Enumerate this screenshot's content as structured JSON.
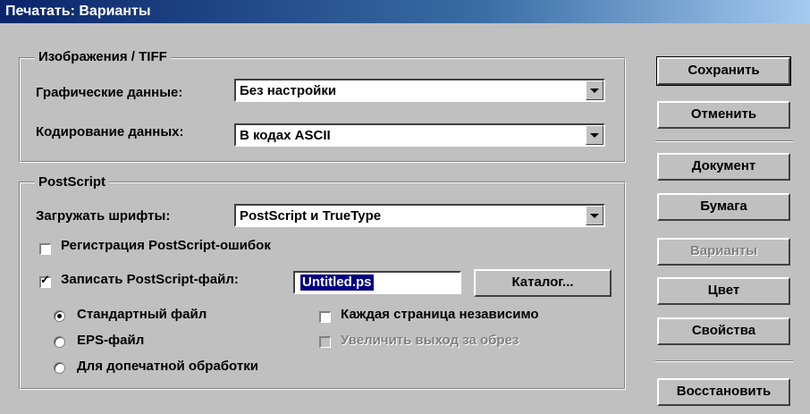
{
  "window": {
    "title": "Печатать: Варианты"
  },
  "images_group": {
    "legend": "Изображения / TIFF",
    "graphic_data_label": "Графические данные:",
    "graphic_data_value": "Без настройки",
    "encoding_label": "Кодирование данных:",
    "encoding_value": "В кодах ASCII"
  },
  "postscript_group": {
    "legend": "PostScript",
    "download_fonts_label": "Загружать шрифты:",
    "download_fonts_value": "PostScript и TrueType",
    "error_log_label": "Регистрация PostScript-ошибок",
    "error_log_checked": false,
    "write_file_label": "Записать PostScript-файл:",
    "write_file_checked": true,
    "filename": "Untitled.ps",
    "catalog_button": "Каталог...",
    "radio_standard": "Стандартный файл",
    "radio_eps": "EPS-файл",
    "radio_prepress": "Для допечатной обработки",
    "selected_radio": "standard",
    "each_page_label": "Каждая страница независимо",
    "each_page_checked": false,
    "bleed_label": "Увеличить выход за обрез",
    "bleed_checked": false
  },
  "buttons": {
    "save": "Сохранить",
    "cancel": "Отменить",
    "document": "Документ",
    "paper": "Бумага",
    "options": "Варианты",
    "color": "Цвет",
    "properties": "Свойства",
    "restore": "Восстановить"
  }
}
